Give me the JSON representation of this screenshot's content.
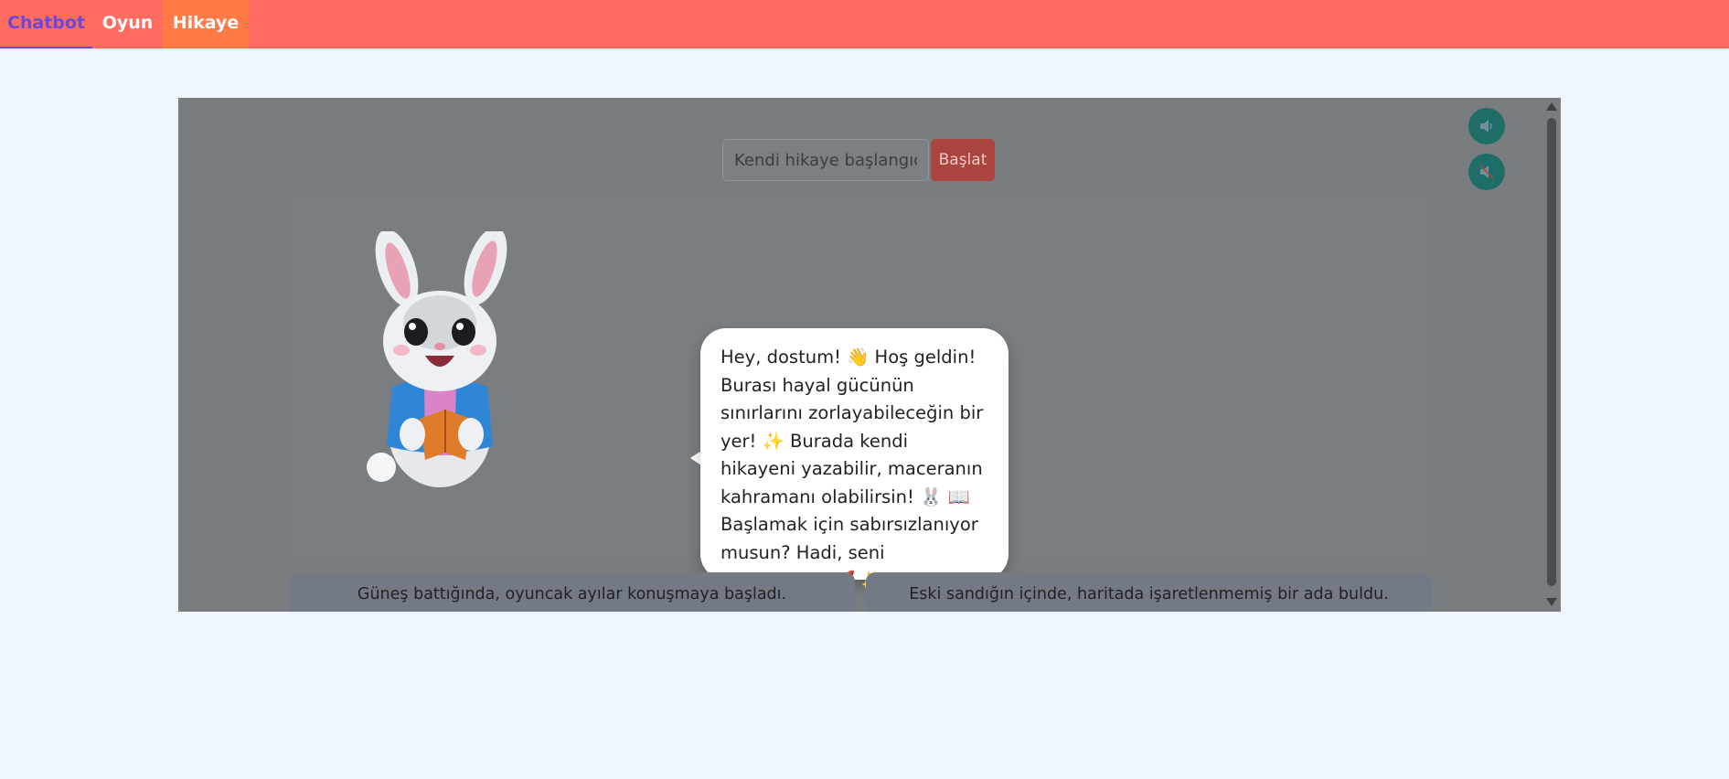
{
  "nav": {
    "tabs": [
      {
        "label": "Chatbot"
      },
      {
        "label": "Oyun"
      },
      {
        "label": "Hikaye"
      }
    ]
  },
  "story": {
    "input_placeholder": "Kendi hikaye başlangıcınızı",
    "start_label": "Başlat",
    "bubble_text": "Hey, dostum! 👋 Hoş geldin! Burası hayal gücünün sınırlarını zorlayabileceğin bir yer! ✨ Burada kendi hikayeni yazabilir, maceranın kahramanı olabilirsin! 🐰 📖 Başlamak için sabırsızlanıyor musun? Hadi, seni bekliyorum! 🚀 ✨",
    "choices": [
      {
        "label": "Güneş battığında, oyuncak ayılar konuşmaya başladı."
      },
      {
        "label": "Eski sandığın içinde, haritada işaretlenmemiş bir ada buldu."
      }
    ]
  },
  "icons": {
    "sound_on": "speaker-icon",
    "sound_off": "mute-icon"
  },
  "colors": {
    "nav_bg": "#ff6b5e",
    "active_tab_text": "#6a48d8",
    "hikaye_tab_bg": "#ff7a45",
    "start_button": "#a9443e",
    "audio_button": "#1e6d66",
    "page_bg": "#eef5fd"
  }
}
